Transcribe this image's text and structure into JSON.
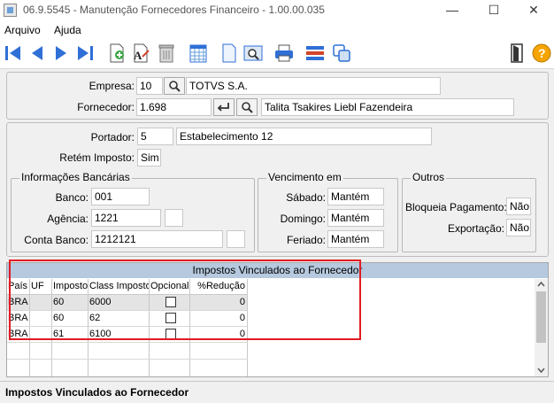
{
  "window": {
    "title": "06.9.5545 - Manutenção Fornecedores Financeiro - 1.00.00.035",
    "minimize": "—",
    "maximize": "☐",
    "close": "✕"
  },
  "menu": {
    "items": [
      "Arquivo",
      "Ajuda"
    ]
  },
  "header": {
    "empresa_label": "Empresa:",
    "empresa_code": "10",
    "empresa_name": "TOTVS S.A.",
    "fornecedor_label": "Fornecedor:",
    "fornecedor_code": "1.698",
    "fornecedor_name": "Talita Tsakires Liebl Fazendeira"
  },
  "details": {
    "portador_label": "Portador:",
    "portador_code": "5",
    "portador_name": "Estabelecimento 12",
    "retem_label": "Retém Imposto:",
    "retem_value": "Sim"
  },
  "bank": {
    "title": "Informações Bancárias",
    "banco_label": "Banco:",
    "banco_value": "001",
    "agencia_label": "Agência:",
    "agencia_value": "1221",
    "conta_label": "Conta Banco:",
    "conta_value": "1212121"
  },
  "vencimento": {
    "title": "Vencimento em",
    "sabado_label": "Sábado:",
    "sabado_value": "Mantém",
    "domingo_label": "Domingo:",
    "domingo_value": "Mantém",
    "feriado_label": "Feriado:",
    "feriado_value": "Mantém"
  },
  "outros": {
    "title": "Outros",
    "bloqueia_label": "Bloqueia Pagamento:",
    "bloqueia_value": "Não",
    "exportacao_label": "Exportação:",
    "exportacao_value": "Não"
  },
  "grid": {
    "title": "Impostos Vinculados ao Fornecedor",
    "columns": [
      "País",
      "UF",
      "Imposto",
      "Class Imposto",
      "Opcional",
      "%Redução"
    ],
    "rows": [
      [
        "BRA",
        "",
        "60",
        "6000",
        "",
        "0"
      ],
      [
        "BRA",
        "",
        "60",
        "62",
        "",
        "0"
      ],
      [
        "BRA",
        "",
        "61",
        "6100",
        "",
        "0"
      ]
    ]
  },
  "status": {
    "text": "Impostos Vinculados ao Fornecedor"
  },
  "colors": {
    "highlight": "#e01b24",
    "grid_title_bg": "#b6c9de",
    "toolbar_blue": "#2f6fd6"
  },
  "icons": [
    "first-icon",
    "prev-icon",
    "next-icon",
    "last-icon",
    "add-icon",
    "edit-icon",
    "delete-icon",
    "calendar-icon",
    "document-icon",
    "find-icon",
    "print-icon",
    "list-icon",
    "copy-icon",
    "exit-icon",
    "help-icon",
    "search-icon",
    "enter-icon",
    "chevron-up-icon",
    "chevron-down-icon"
  ]
}
